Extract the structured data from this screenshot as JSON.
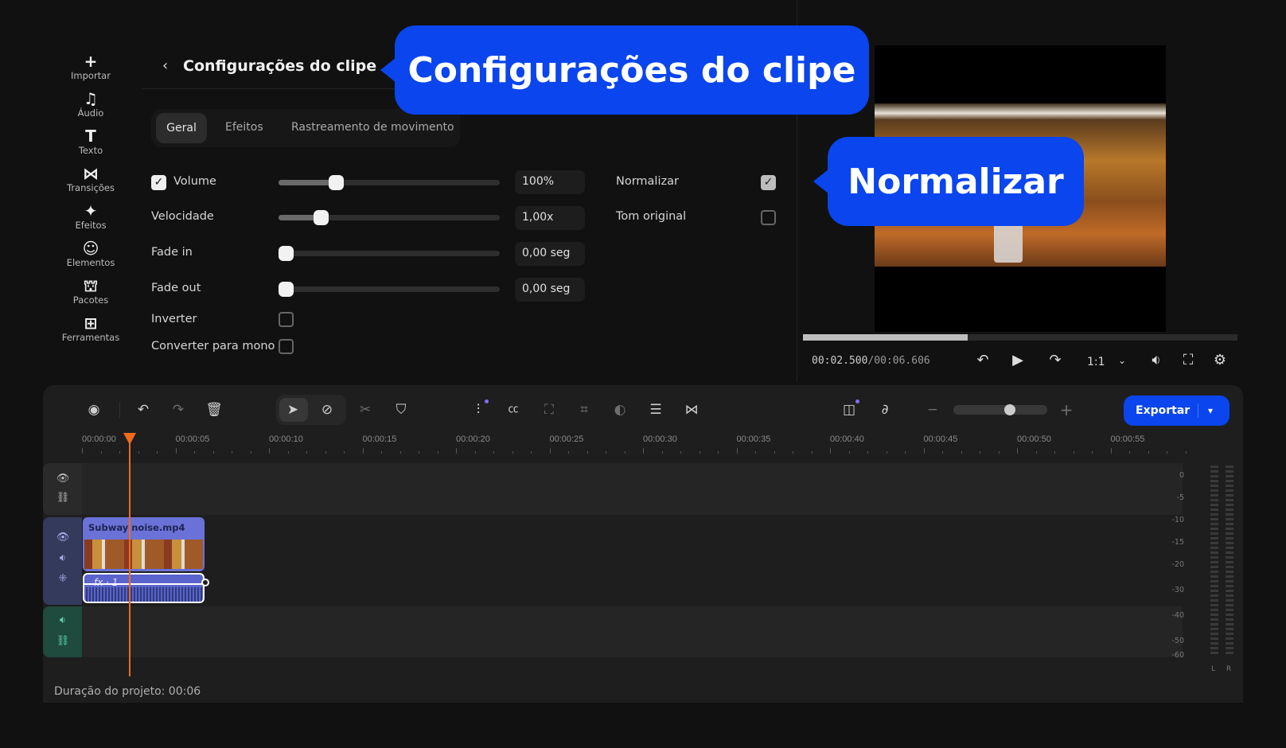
{
  "sidebar": {
    "items": [
      {
        "label": "Importar",
        "icon": "plus-icon"
      },
      {
        "label": "Áudio",
        "icon": "music-note-icon"
      },
      {
        "label": "Texto",
        "icon": "text-icon"
      },
      {
        "label": "Transições",
        "icon": "transition-icon"
      },
      {
        "label": "Efeitos",
        "icon": "sparkle-icon"
      },
      {
        "label": "Elementos",
        "icon": "smiley-icon"
      },
      {
        "label": "Pacotes",
        "icon": "bag-icon"
      },
      {
        "label": "Ferramentas",
        "icon": "tools-grid-icon"
      }
    ]
  },
  "panel": {
    "title": "Configurações do clipe",
    "tabs": [
      {
        "label": "Geral",
        "active": true
      },
      {
        "label": "Efeitos"
      },
      {
        "label": "Rastreamento de movimento"
      }
    ],
    "volume": {
      "label": "Volume",
      "checked": true,
      "value": "100%",
      "fraction": 0.26
    },
    "speed": {
      "label": "Velocidade",
      "value": "1,00x",
      "fraction": 0.19
    },
    "fade_in": {
      "label": "Fade in",
      "value": "0,00 seg",
      "fraction": 0
    },
    "fade_out": {
      "label": "Fade out",
      "value": "0,00 seg",
      "fraction": 0
    },
    "invert": {
      "label": "Inverter",
      "checked": false
    },
    "mono": {
      "label": "Converter para mono",
      "checked": false
    },
    "normalize": {
      "label": "Normalizar",
      "checked": true
    },
    "original_pitch": {
      "label": "Tom original",
      "checked": false
    }
  },
  "callouts": {
    "clip_settings": "Configurações do clipe",
    "normalize": "Normalizar"
  },
  "player": {
    "time_current": "00:02.500",
    "time_total": "/00:06.606",
    "progress": 0.38,
    "aspect": "1:1"
  },
  "timeline": {
    "export_label": "Exportar",
    "zoom_level": 0.6,
    "ruler": [
      "00:00:00",
      "00:00:05",
      "00:00:10",
      "00:00:15",
      "00:00:20",
      "00:00:25",
      "00:00:30",
      "00:00:35",
      "00:00:40",
      "00:00:45",
      "00:00:50",
      "00:00:55"
    ],
    "clip": {
      "name": "Subway noise.mp4",
      "fx": "fx · 1"
    },
    "meter_labels": [
      "0",
      "-5",
      "-10",
      "-15",
      "-20",
      "-30",
      "-40",
      "-50",
      "-60"
    ],
    "channels": [
      "L",
      "R"
    ],
    "duration": "Duração do projeto: 00:06"
  },
  "colors": {
    "accent": "#0a45ee",
    "playhead": "#f06a1a",
    "video_track": "#343a5c",
    "audio_track": "#1f4a3e",
    "clip": "#6a72d8"
  }
}
